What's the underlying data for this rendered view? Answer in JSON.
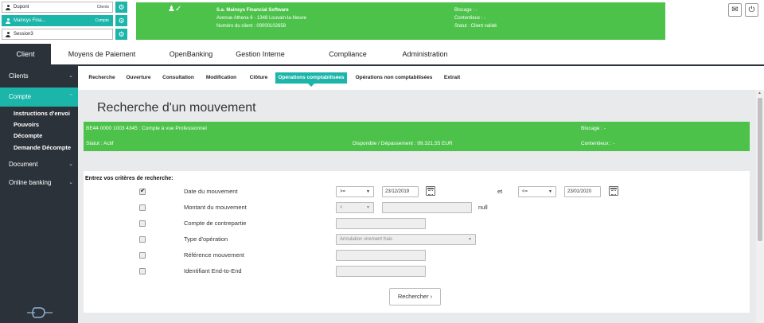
{
  "sessions": [
    {
      "name": "Dupont",
      "tag": "Clients",
      "active": false
    },
    {
      "name": "Mainsys Fina...",
      "tag": "Compte",
      "active": true
    },
    {
      "name": "Session3",
      "tag": "",
      "active": false
    }
  ],
  "client_banner": {
    "name": "S.a. Mainsys Financial Software",
    "address": "Avenue Athena 6 - 1348 Louvain-la-Neuve",
    "client_number": "Numéro du client : 00000102658",
    "blocage": "Blocage : -",
    "contentieux": "Contentieux : -",
    "statut": "Statut : Client validé"
  },
  "main_tabs": [
    "Client",
    "Moyens de Paiement",
    "OpenBanking",
    "Gestion Interne",
    "Compliance",
    "Administration"
  ],
  "sidebar": {
    "items": [
      "Clients",
      "Compte",
      "Document",
      "Online banking"
    ],
    "sub_items": [
      "Instructions d'envoi",
      "Pouvoirs",
      "Décompte",
      "Demande Décompte"
    ]
  },
  "sub_tabs": [
    "Recherche",
    "Ouverture",
    "Consultation",
    "Modification",
    "Clôture",
    "Opérations comptabilisées",
    "Opérations non comptabilisées",
    "Extrait"
  ],
  "page_title": "Recherche d'un mouvement",
  "account": {
    "label": "BE44 0000 1003 4345 : Compte à vue Professionnel",
    "statut": "Statut : Actif",
    "disponible": "Disponible / Dépassement : 99.321,55 EUR",
    "blocage": "Blocage : -",
    "contentieux": "Contentieux : -"
  },
  "criteria": {
    "title": "Entrez vos critères de recherche:",
    "rows": [
      {
        "label": "Date du mouvement",
        "checked": true
      },
      {
        "label": "Montant du mouvement",
        "checked": false
      },
      {
        "label": "Compte de contrepartie",
        "checked": false
      },
      {
        "label": "Type d'opération",
        "checked": false
      },
      {
        "label": "Référence mouvement",
        "checked": false
      },
      {
        "label": "Identifiant End-to-End",
        "checked": false
      }
    ],
    "date_op1": ">=",
    "date_from": "23/12/2019",
    "et": "et",
    "date_op2": "<=",
    "date_to": "23/01/2020",
    "amount_op": "<",
    "null_label": "null",
    "type_value": "Annulation virement frais",
    "search_button": "Rechercher ›"
  },
  "colors": {
    "green": "#4cc24a",
    "teal": "#1bb5a9",
    "dark": "#2c3239"
  }
}
